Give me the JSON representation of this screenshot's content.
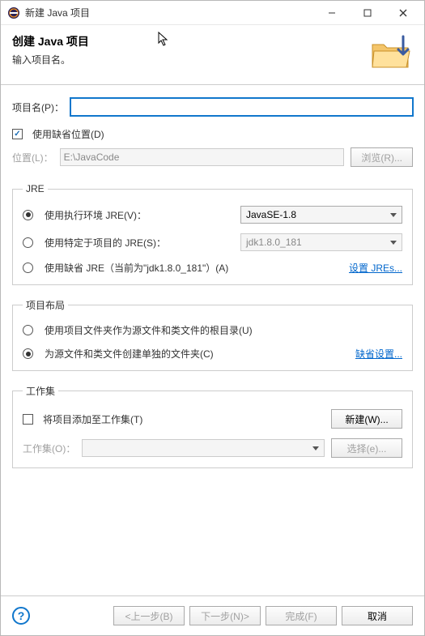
{
  "titlebar": {
    "title": "新建 Java 项目"
  },
  "header": {
    "title": "创建 Java 项目",
    "subtitle": "输入项目名。"
  },
  "project_name": {
    "label": "项目名(P)：",
    "value": ""
  },
  "default_loc": {
    "checkbox_label": "使用缺省位置(D)",
    "checked": true
  },
  "location": {
    "label": "位置(L)：",
    "value": "E:\\JavaCode",
    "browse": "浏览(R)..."
  },
  "jre": {
    "legend": "JRE",
    "opt1": {
      "label": "使用执行环境 JRE(V)：",
      "value": "JavaSE-1.8"
    },
    "opt2": {
      "label": "使用特定于项目的 JRE(S)：",
      "value": "jdk1.8.0_181"
    },
    "opt3": {
      "label": "使用缺省 JRE（当前为\"jdk1.8.0_181\"）(A)"
    },
    "link": "设置 JREs..."
  },
  "layout": {
    "legend": "项目布局",
    "opt1": "使用项目文件夹作为源文件和类文件的根目录(U)",
    "opt2": "为源文件和类文件创建单独的文件夹(C)",
    "link": "缺省设置..."
  },
  "workingset": {
    "legend": "工作集",
    "checkbox": "将项目添加至工作集(T)",
    "new_btn": "新建(W)...",
    "label": "工作集(O)：",
    "select_btn": "选择(e)..."
  },
  "footer": {
    "back": "<上一步(B)",
    "next": "下一步(N)>",
    "finish": "完成(F)",
    "cancel": "取消"
  }
}
